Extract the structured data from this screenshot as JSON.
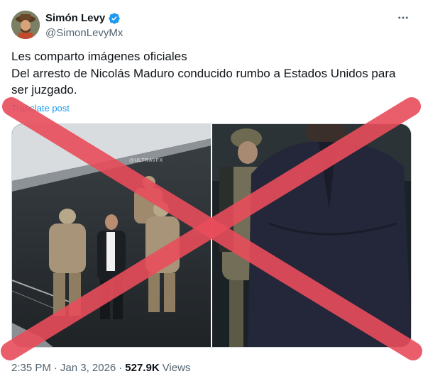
{
  "author": {
    "name": "Simón Levy",
    "handle": "@SimonLevyMx",
    "verified": true
  },
  "tweet": {
    "text": "Les comparto imágenes oficiales\nDel arresto de Nicolás Maduro conducido rumbo a Estados Unidos para ser juzgado.",
    "translate_label": "Translate post"
  },
  "media": {
    "watermark": "@ULTRAVFX",
    "overlay": "red-x-false-mark",
    "overlay_color": "#e84d5b"
  },
  "meta": {
    "time": "2:35 PM",
    "separator1": "·",
    "date": "Jan 3, 2026",
    "separator2": "·",
    "views_count": "527.9K",
    "views_label": "Views"
  },
  "colors": {
    "link": "#1d9bf0",
    "secondary_text": "#536471",
    "verified_badge": "#1d9bf0"
  }
}
